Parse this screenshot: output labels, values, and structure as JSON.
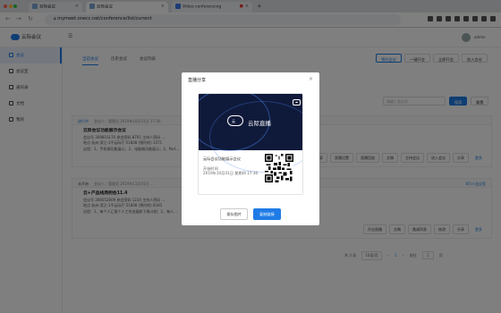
{
  "browser": {
    "tabs": [
      {
        "label": "云际会议",
        "color": "#7aa6d6"
      },
      {
        "label": "云际会议",
        "color": "#7aa6d6"
      },
      {
        "label": "Video conferencing",
        "color": "#3e79ef"
      }
    ],
    "new_tab": "+",
    "url": "mymeet.onecc.net/conference/list/current",
    "secure_icon": "lock-icon"
  },
  "app": {
    "logo_text": "云际会议",
    "user_name": "admin",
    "sidebar": [
      {
        "label": "会议"
      },
      {
        "label": "会议室"
      },
      {
        "label": "通讯录"
      },
      {
        "label": "文档"
      },
      {
        "label": "我的"
      }
    ],
    "tabs": [
      {
        "label": "当前会议"
      },
      {
        "label": "历史会议"
      },
      {
        "label": "会议列表"
      }
    ],
    "top_buttons": [
      "预约会议",
      "一键开会",
      "立即开会",
      "加入会议"
    ],
    "filter_placeholder": "请输入会议号",
    "search_button": "搜索",
    "reset_button": "重置",
    "cards": [
      {
        "status": "进行中",
        "organizer": "会议人：管理员",
        "time": "2019年10月31日 17:30",
        "title": "云际会议功能展示会议",
        "meta": "会议号 309810170   参会密码 8791   主持人密码 …",
        "location": "地点 杭州·滨江·1平云际厅·51808 (预约的)   3371",
        "desc": "议程：1、手机端功能展示；2、电脑端功能展示；3、Pad…",
        "buttons": [
          "分享",
          "直播设置",
          "直播回放",
          "文稿",
          "主持会议",
          "进入会议",
          "分享",
          "更多"
        ]
      },
      {
        "status": "未开始",
        "organizer": "会议人：管理员",
        "time": "2019年11月01日 …",
        "title": "云+产品线周例会11.4",
        "meta": "会议号 306052809   参会密码 1234   主持人密码 …",
        "location": "地点 杭州·滨江·1平云际厅·51808 (预约的)   8183",
        "desc": "议程：1、每个人汇报个人工作进展和下周计划；2、每人…",
        "extra": "87/人会议室",
        "buttons": [
          "开启直播",
          "文稿",
          "邀请列表",
          "修改",
          "分享",
          "更多"
        ]
      }
    ],
    "pager": {
      "total": "共 3 条",
      "size": "10条/页",
      "page": "1",
      "goto": "前往",
      "goto_page": "1",
      "unit": "页"
    }
  },
  "modal": {
    "title": "直播分享",
    "close": "×",
    "banner_title": "云际直播",
    "cloud_label": "云",
    "meeting_title": "云际会议功能展示会议",
    "start_label": "开始时间",
    "start_time": "2019年10月31日 星期四 17:30",
    "save_button": "保存图片",
    "copy_button": "复制链接"
  },
  "colors": {
    "brand": "#1f7ce6",
    "banner_bg": "#0f1a3a"
  }
}
